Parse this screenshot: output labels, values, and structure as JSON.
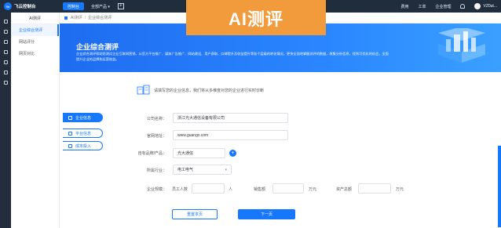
{
  "topbar": {
    "logo_mark": "Ye",
    "logo_text": "飞云控制台",
    "nav": [
      "控制台",
      "全部产品 ▾"
    ],
    "add": "+",
    "right": [
      "费用",
      "工单",
      "企业管理"
    ],
    "user": "VZ0ut..."
  },
  "banner": {
    "text": "AI测评"
  },
  "side": {
    "title": "AI测评",
    "items": [
      "企业综合测评",
      "网站评分",
      "网页对比"
    ]
  },
  "breadcrumb": [
    "AI测评",
    "企业综合测评"
  ],
  "hero": {
    "title": "企业综合测评",
    "desc": "企业综合测评帮助您测试企业互联网营销，从官方平台推广、媒体广告推广、网站建设、用户获取、口碑提升及收益提升等各个层级的转化情况，更快全面地掌握测评的数据，收集分析信息，找到可优化的机会，全面提升企业的品牌和运营效益。"
  },
  "tip": "请填写您的企业信息，我们将从多维度对您的企业进行实时诊断",
  "steps": [
    "企业信息",
    "平台信息",
    "成本投入"
  ],
  "form": {
    "company_label": "公司名称：",
    "company_value": "浙江光大通信设备有限公司",
    "website_label": "官网地址：",
    "website_value": "www.guangx.com",
    "brand_label": "自有品牌/产品：",
    "brand_value": "光大通信",
    "industry_label": "所属行业：",
    "industry_value": "电工电气",
    "scale_label": "企业规模：",
    "staff_label": "员工人数",
    "staff_unit": "人",
    "sales_label": "销售额",
    "sales_unit": "万元",
    "assets_label": "资产总额",
    "assets_unit": "万元",
    "add_symbol": "+",
    "caret": "▾"
  },
  "buttons": {
    "reset": "重置本页",
    "next": "下一页"
  },
  "colors": {
    "primary": "#1677ff",
    "banner": "#f29b3c",
    "topbar": "#1f2d3d"
  }
}
